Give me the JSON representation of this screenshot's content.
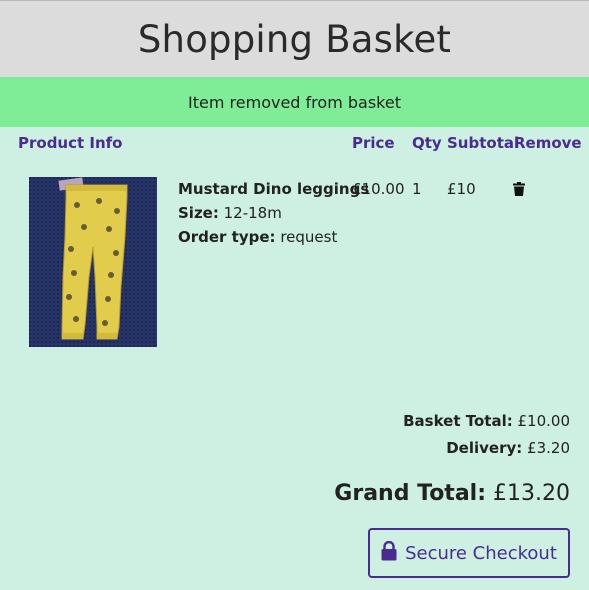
{
  "header": {
    "title": "Shopping Basket"
  },
  "alert": {
    "message": "Item removed from basket"
  },
  "table": {
    "headers": {
      "product": "Product Info",
      "price": "Price",
      "qty": "Qty",
      "subtotal": "Subtotal",
      "remove": "Remove"
    },
    "rows": [
      {
        "name": "Mustard Dino leggings",
        "size_label": "Size:",
        "size": "12-18m",
        "order_type_label": "Order type:",
        "order_type": "request",
        "price": "£10.00",
        "qty": "1",
        "subtotal": "£10",
        "remove_icon": "trash-icon"
      }
    ]
  },
  "totals": {
    "basket_label": "Basket Total:",
    "basket_value": "£10.00",
    "delivery_label": "Delivery:",
    "delivery_value": "£3.20",
    "grand_label": "Grand Total:",
    "grand_value": "£13.20"
  },
  "checkout": {
    "label": "Secure Checkout",
    "icon": "lock-icon"
  },
  "colors": {
    "accent": "#4a2c91",
    "alert_bg": "#7fec97",
    "page_bg": "#cdf0e3",
    "header_bg": "#dcdcdc"
  }
}
